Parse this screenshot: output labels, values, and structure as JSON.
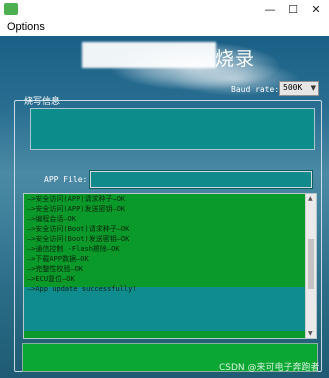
{
  "window": {
    "minimize_glyph": "—",
    "maximize_glyph": "☐",
    "close_glyph": "✕"
  },
  "menu": {
    "options_label": "Options"
  },
  "banner": {
    "title": "烧录"
  },
  "baud": {
    "label": "Baud rate:",
    "value": "500K"
  },
  "group": {
    "title": "烧写信息"
  },
  "appfile": {
    "label": "APP File:",
    "value": ""
  },
  "log": {
    "lines": [
      "—>安全访问(APP)请求种子—OK",
      "—>安全访问(APP)发送密钥—OK",
      "—>编程会话—OK",
      "—>安全访问(Boot)请求种子—OK",
      "—>安全访问(Boot)发送密钥—OK",
      "—>通信控制 -Flash擦除—OK",
      "—>下载APP数据—OK",
      "—>完整性校验—OK",
      "—>ECU复位—OK",
      "—>App update successfully!"
    ]
  },
  "progress": {
    "value": 1.0
  },
  "watermark": "CSDN @来可电子奔跑者",
  "colors": {
    "teal_box": "#0d8c8c",
    "log_bg": "#0a9a2a",
    "progress_fill": "#0aa832",
    "background": "#2a6f92"
  }
}
